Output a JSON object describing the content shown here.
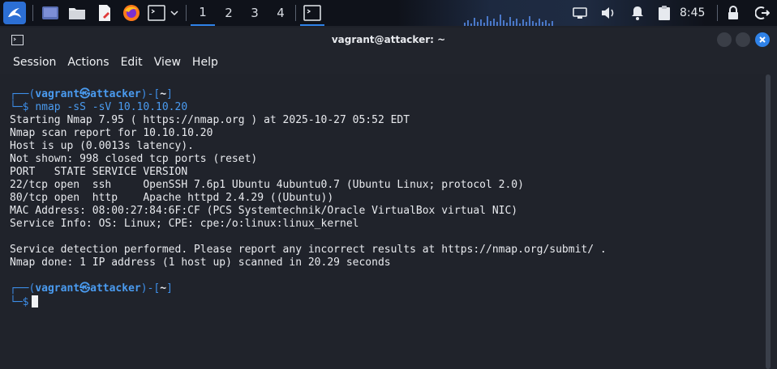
{
  "taskbar": {
    "workspaces": [
      "1",
      "2",
      "3",
      "4"
    ],
    "active_workspace": "1",
    "clock": "8:45",
    "accent_color": "#2f82e8",
    "icons": [
      "kali-menu-icon",
      "show-desktop-icon",
      "file-manager-icon",
      "text-editor-icon",
      "firefox-icon",
      "terminal-icon",
      "chevron-down-icon",
      "terminal-task-icon",
      "network-icon",
      "volume-icon",
      "notification-bell-icon",
      "clipboard-icon",
      "lock-icon",
      "logout-icon"
    ]
  },
  "window": {
    "title": "vagrant@attacker: ~",
    "menu": [
      "Session",
      "Actions",
      "Edit",
      "View",
      "Help"
    ]
  },
  "terminal": {
    "prompt": {
      "open": "┌──(",
      "user": "vagrant",
      "at": "㉿",
      "host": "attacker",
      "dir_open": ")-[",
      "dir": "~",
      "dir_close": "]",
      "second": "└─$"
    },
    "command": {
      "name": "nmap",
      "args": " -sS -sV 10.10.10.20"
    },
    "output": [
      "Starting Nmap 7.95 ( https://nmap.org ) at 2025-10-27 05:52 EDT",
      "Nmap scan report for 10.10.10.20",
      "Host is up (0.0013s latency).",
      "Not shown: 998 closed tcp ports (reset)",
      "PORT   STATE SERVICE VERSION",
      "22/tcp open  ssh     OpenSSH 7.6p1 Ubuntu 4ubuntu0.7 (Ubuntu Linux; protocol 2.0)",
      "80/tcp open  http    Apache httpd 2.4.29 ((Ubuntu))",
      "MAC Address: 08:00:27:84:6F:CF (PCS Systemtechnik/Oracle VirtualBox virtual NIC)",
      "Service Info: OS: Linux; CPE: cpe:/o:linux:linux_kernel",
      "",
      "Service detection performed. Please report any incorrect results at https://nmap.org/submit/ .",
      "Nmap done: 1 IP address (1 host up) scanned in 20.29 seconds"
    ]
  }
}
